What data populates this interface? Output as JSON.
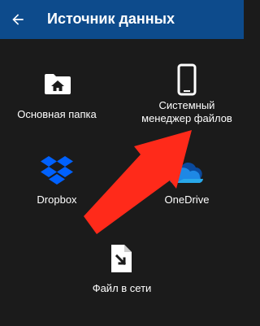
{
  "app_bar": {
    "title": "Источник данных",
    "back_icon": "arrow-back-icon",
    "background": "#0d4b8c"
  },
  "sources": [
    {
      "id": "primary-folder",
      "label": "Основная папка",
      "icon": "home-folder-icon"
    },
    {
      "id": "system-file-manager",
      "label_line1": "Системный",
      "label_line2": "менеджер файлов",
      "icon": "smartphone-icon"
    },
    {
      "id": "dropbox",
      "label": "Dropbox",
      "icon": "dropbox-icon",
      "color": "#0061fe"
    },
    {
      "id": "onedrive",
      "label": "OneDrive",
      "icon": "onedrive-cloud-icon",
      "color": "#1e88e5"
    },
    {
      "id": "network-file",
      "label": "Файл в сети",
      "icon": "file-download-icon"
    }
  ],
  "annotation": {
    "icon": "red-arrow-icon",
    "color": "#ff2a1a"
  },
  "colors": {
    "background": "#1b1b1b",
    "text": "#ffffff"
  }
}
